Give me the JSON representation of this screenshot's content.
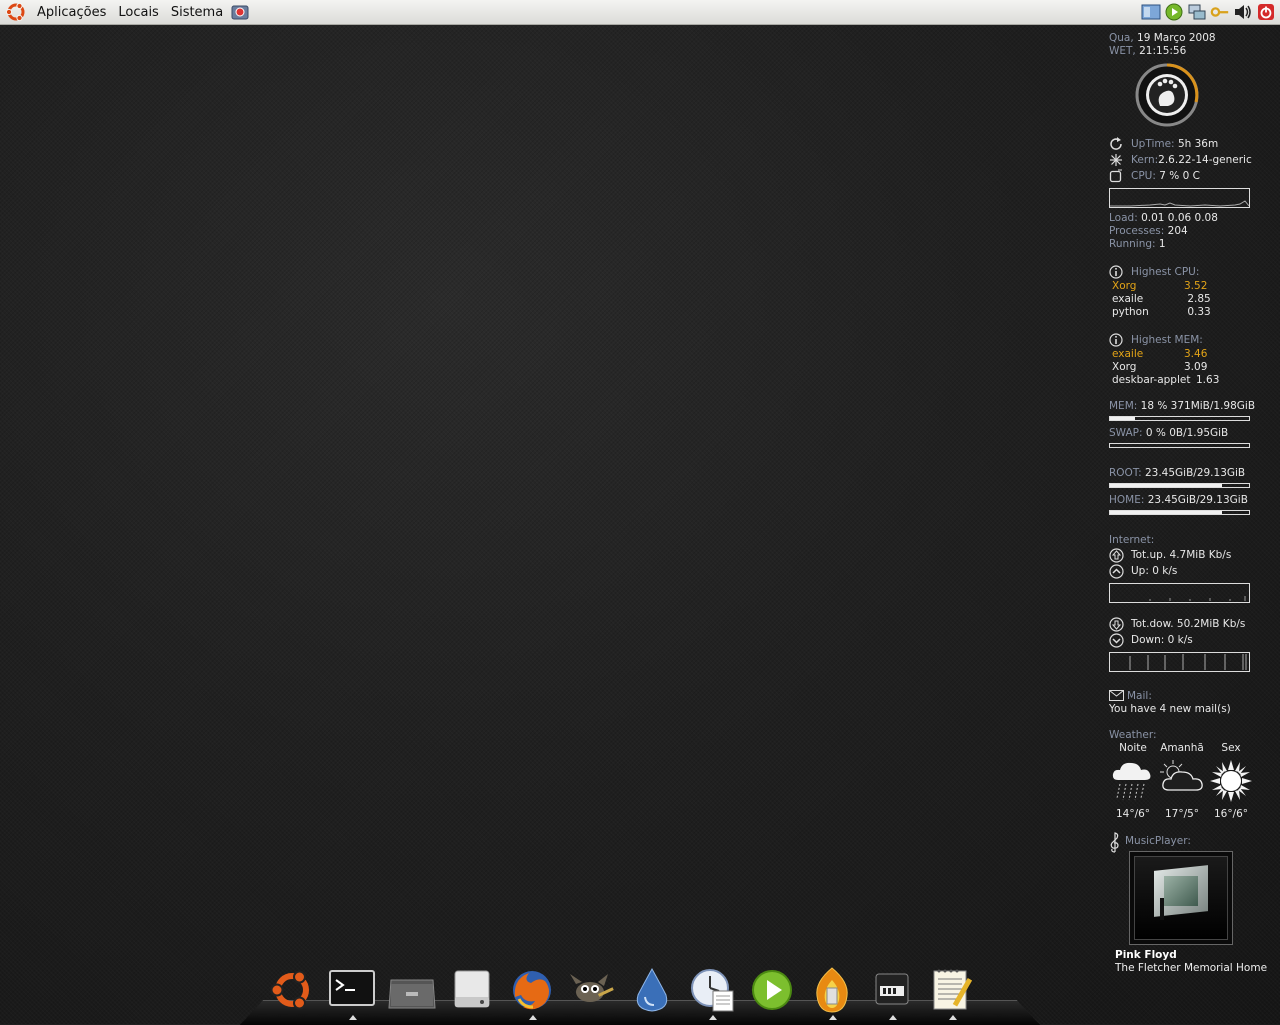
{
  "top_panel": {
    "menus": [
      "Aplicações",
      "Locais",
      "Sistema"
    ]
  },
  "conky": {
    "date_label": "Qua,",
    "date_value": "19 Março 2008",
    "tz_label": "WET,",
    "time_value": "21:15:56",
    "uptime_label": "UpTime:",
    "uptime_value": "5h 36m",
    "kern_label": "Kern:",
    "kern_value": "2.6.22-14-generic",
    "cpu_label": "CPU:",
    "cpu_value": "7  % 0   C",
    "load_label": "Load:",
    "load_value": "0.01 0.06 0.08",
    "processes_label": "Processes:",
    "processes_value": "204",
    "running_label": "Running:",
    "running_value": "1",
    "highest_cpu_label": "Highest CPU:",
    "highest_cpu": [
      {
        "name": "Xorg",
        "value": "3.52"
      },
      {
        "name": "exaile",
        "value": "2.85"
      },
      {
        "name": "python",
        "value": "0.33"
      }
    ],
    "highest_mem_label": "Highest MEM:",
    "highest_mem": [
      {
        "name": "exaile",
        "value": "3.46"
      },
      {
        "name": "Xorg",
        "value": "3.09"
      },
      {
        "name": "deskbar-applet",
        "value": "1.63"
      }
    ],
    "mem_label": "MEM:",
    "mem_value": "18 % 371MiB/1.98GiB",
    "mem_fraction": 0.18,
    "swap_label": "SWAP:",
    "swap_value": "0  % 0B/1.95GiB",
    "swap_fraction": 0.0,
    "root_label": "ROOT:",
    "root_value": "23.45GiB/29.13GiB",
    "root_fraction": 0.805,
    "home_label": "HOME:",
    "home_value": "23.45GiB/29.13GiB",
    "home_fraction": 0.805,
    "internet_label": "Internet:",
    "totup_label": "Tot.up.",
    "totup_value": "4.7MiB Kb/s",
    "up_label": "Up:",
    "up_value": "0    k/s",
    "totdown_label": "Tot.dow.",
    "totdown_value": "50.2MiB Kb/s",
    "down_label": "Down:",
    "down_value": "0    k/s",
    "mail_label": "Mail:",
    "mail_value": "You have 4 new mail(s)",
    "weather_label": "Weather:",
    "weather": [
      {
        "day": "Noite",
        "temp": "14°/6°",
        "icon": "rain-cloud-icon"
      },
      {
        "day": "Amanhã",
        "temp": "17°/5°",
        "icon": "partly-cloudy-icon"
      },
      {
        "day": "Sex",
        "temp": "16°/6°",
        "icon": "sun-icon"
      }
    ],
    "music_label": "MusicPlayer:",
    "music_artist": "Pink Floyd",
    "music_album": "The Fletcher Memorial Home"
  },
  "dock": {
    "items": [
      "ubuntu-icon",
      "terminal-icon",
      "file-cabinet-icon",
      "drive-icon",
      "firefox-icon",
      "gimp-icon",
      "deluge-icon",
      "evolution-icon",
      "media-player-icon",
      "pidgin-like-icon",
      "network-icon",
      "text-editor-icon"
    ]
  },
  "colors": {
    "accent": "#e3a417",
    "label": "#8a93a6",
    "text": "#e8e8e8",
    "panel": "#e6e6e2"
  }
}
